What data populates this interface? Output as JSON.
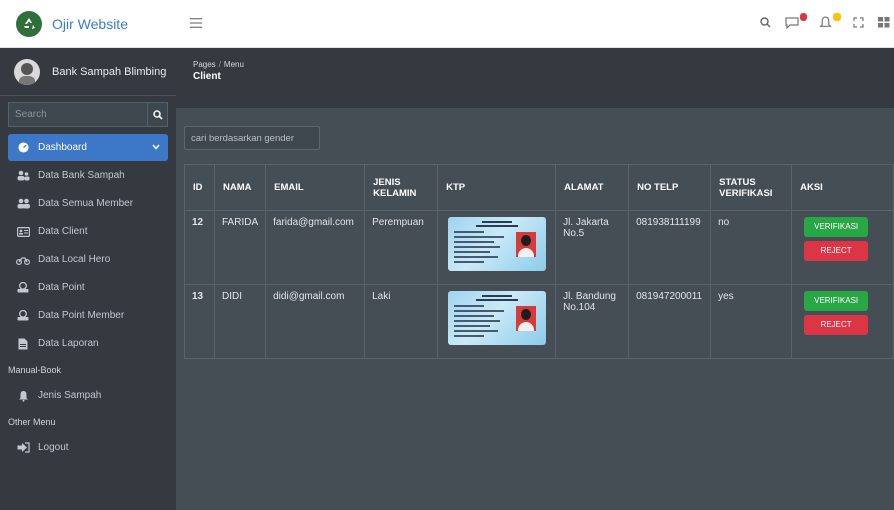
{
  "brand": {
    "name": "Ojir Website"
  },
  "user": {
    "name": "Bank Sampah Blimbing"
  },
  "search": {
    "placeholder": "Search"
  },
  "sidebar": {
    "items": [
      {
        "label": "Dashboard",
        "icon": "dashboard-icon",
        "active": true
      },
      {
        "label": "Data Bank Sampah",
        "icon": "users-icon"
      },
      {
        "label": "Data Semua Member",
        "icon": "users-icon"
      },
      {
        "label": "Data Client",
        "icon": "id-card-icon"
      },
      {
        "label": "Data Local Hero",
        "icon": "motorcycle-icon"
      },
      {
        "label": "Data Point",
        "icon": "coin-icon"
      },
      {
        "label": "Data Point Member",
        "icon": "coin-icon"
      },
      {
        "label": "Data Laporan",
        "icon": "file-icon"
      }
    ],
    "section_manual": "Manual-Book",
    "manual_items": [
      {
        "label": "Jenis Sampah",
        "icon": "bell-icon"
      }
    ],
    "section_other": "Other Menu",
    "other_items": [
      {
        "label": "Logout",
        "icon": "logout-icon"
      }
    ]
  },
  "breadcrumb": {
    "root": "Pages",
    "sep": "/",
    "current": "Menu"
  },
  "page": {
    "title": "Client"
  },
  "filter": {
    "placeholder": "cari berdasarkan gender"
  },
  "table": {
    "headers": {
      "id": "ID",
      "nama": "NAMA",
      "email": "EMAIL",
      "jenis1": "JENIS",
      "jenis2": "KELAMIN",
      "ktp": "KTP",
      "alamat": "ALAMAT",
      "telp": "NO TELP",
      "status1": "STATUS",
      "status2": "VERIFIKASI",
      "aksi": "AKSI"
    },
    "rows": [
      {
        "id": "12",
        "nama": "FARIDA",
        "email": "farida@gmail.com",
        "gender": "Perempuan",
        "alamat1": "Jl. Jakarta",
        "alamat2": "No.5",
        "telp": "081938111199",
        "status": "no"
      },
      {
        "id": "13",
        "nama": "DIDI",
        "email": "didi@gmail.com",
        "gender": "Laki",
        "alamat1": "Jl. Bandung",
        "alamat2": "No.104",
        "telp": "081947200011",
        "status": "yes"
      }
    ],
    "verify_label": "VERIFIKASI",
    "reject_label": "REJECT"
  },
  "colors": {
    "accent": "#3c78c7",
    "success": "#28a745",
    "danger": "#dc3545",
    "sidebar": "#343a40"
  }
}
